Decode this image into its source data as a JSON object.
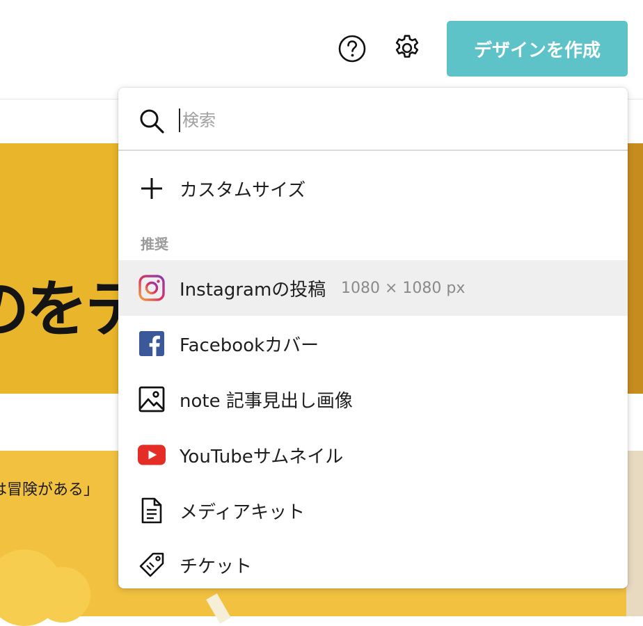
{
  "header": {
    "help_icon": "question-circle-icon",
    "settings_icon": "gear-icon",
    "create_button_label": "デザインを作成",
    "create_button_color": "#5dc3c9"
  },
  "background": {
    "hero_text": "のをテ",
    "quote_text": "は冒険がある」",
    "banner_color": "#e9b52a"
  },
  "dropdown": {
    "search": {
      "placeholder": "検索",
      "value": ""
    },
    "custom_size_label": "カスタムサイズ",
    "section_label": "推奨",
    "items": [
      {
        "icon": "instagram-icon",
        "label": "Instagramの投稿",
        "size": "1080 × 1080 px",
        "highlighted": true
      },
      {
        "icon": "facebook-icon",
        "label": "Facebookカバー"
      },
      {
        "icon": "image-icon",
        "label": "note 記事見出し画像"
      },
      {
        "icon": "youtube-icon",
        "label": "YouTubeサムネイル"
      },
      {
        "icon": "document-icon",
        "label": "メディアキット"
      },
      {
        "icon": "tag-icon",
        "label": "チケット"
      }
    ]
  }
}
